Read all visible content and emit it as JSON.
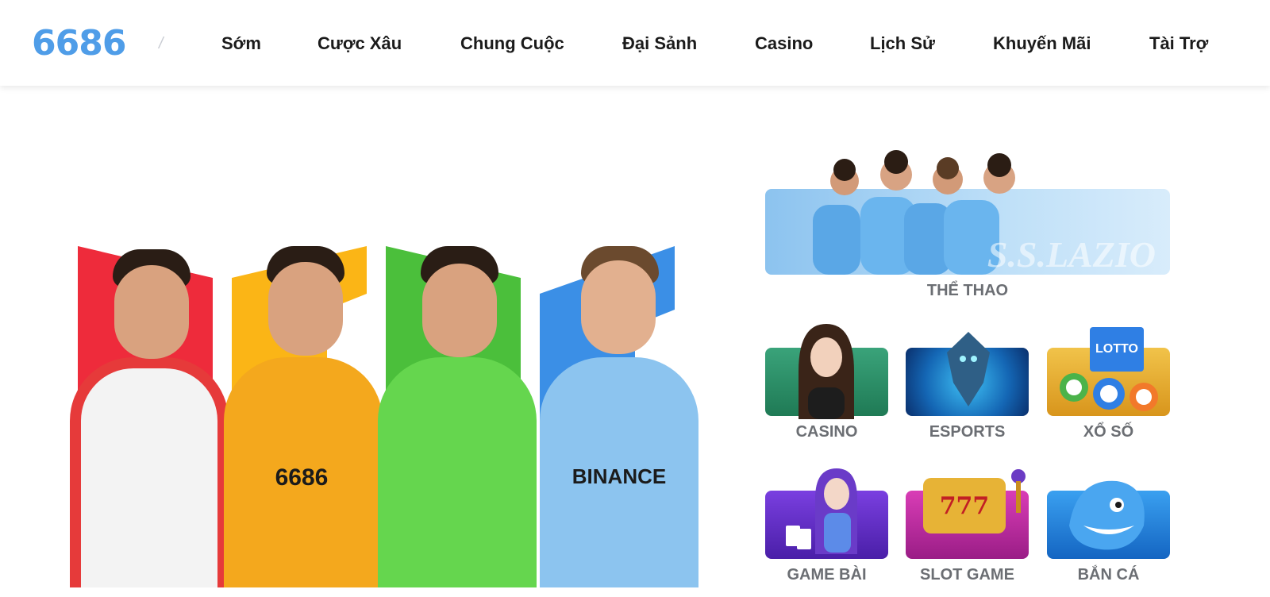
{
  "brand": {
    "logo_text": "6686",
    "accent": "#4f9de8"
  },
  "nav": {
    "items": [
      {
        "label": "Sớm"
      },
      {
        "label": "Cược Xâu"
      },
      {
        "label": "Chung Cuộc"
      },
      {
        "label": "Đại Sảnh"
      },
      {
        "label": "Casino"
      },
      {
        "label": "Lịch Sử"
      },
      {
        "label": "Khuyến Mãi"
      },
      {
        "label": "Tài Trợ"
      }
    ]
  },
  "hero": {
    "players": [
      {
        "name": "player-monaco",
        "stripe_color": "#ee2b3b",
        "shirt_color": "#f3f3f3"
      },
      {
        "name": "player-wolves",
        "stripe_color": "#fbb516",
        "shirt_color": "#f4a81d",
        "sponsor": "6686"
      },
      {
        "name": "player-wolfsburg",
        "stripe_color": "#4bbf3b",
        "shirt_color": "#65d64e"
      },
      {
        "name": "player-lazio",
        "stripe_color": "#3b8fe6",
        "shirt_color": "#8cc4ef",
        "sponsor": "BINANCE"
      }
    ]
  },
  "categories": {
    "featured": {
      "label": "THỂ THAO",
      "banner_text": "S.S.LAZIO"
    },
    "items": [
      {
        "label": "CASINO"
      },
      {
        "label": "ESPORTS"
      },
      {
        "label": "XỔ SỐ",
        "ticket_text": "LOTTO"
      },
      {
        "label": "GAME BÀI"
      },
      {
        "label": "SLOT GAME",
        "reel_text": "777"
      },
      {
        "label": "BẮN CÁ"
      }
    ]
  }
}
